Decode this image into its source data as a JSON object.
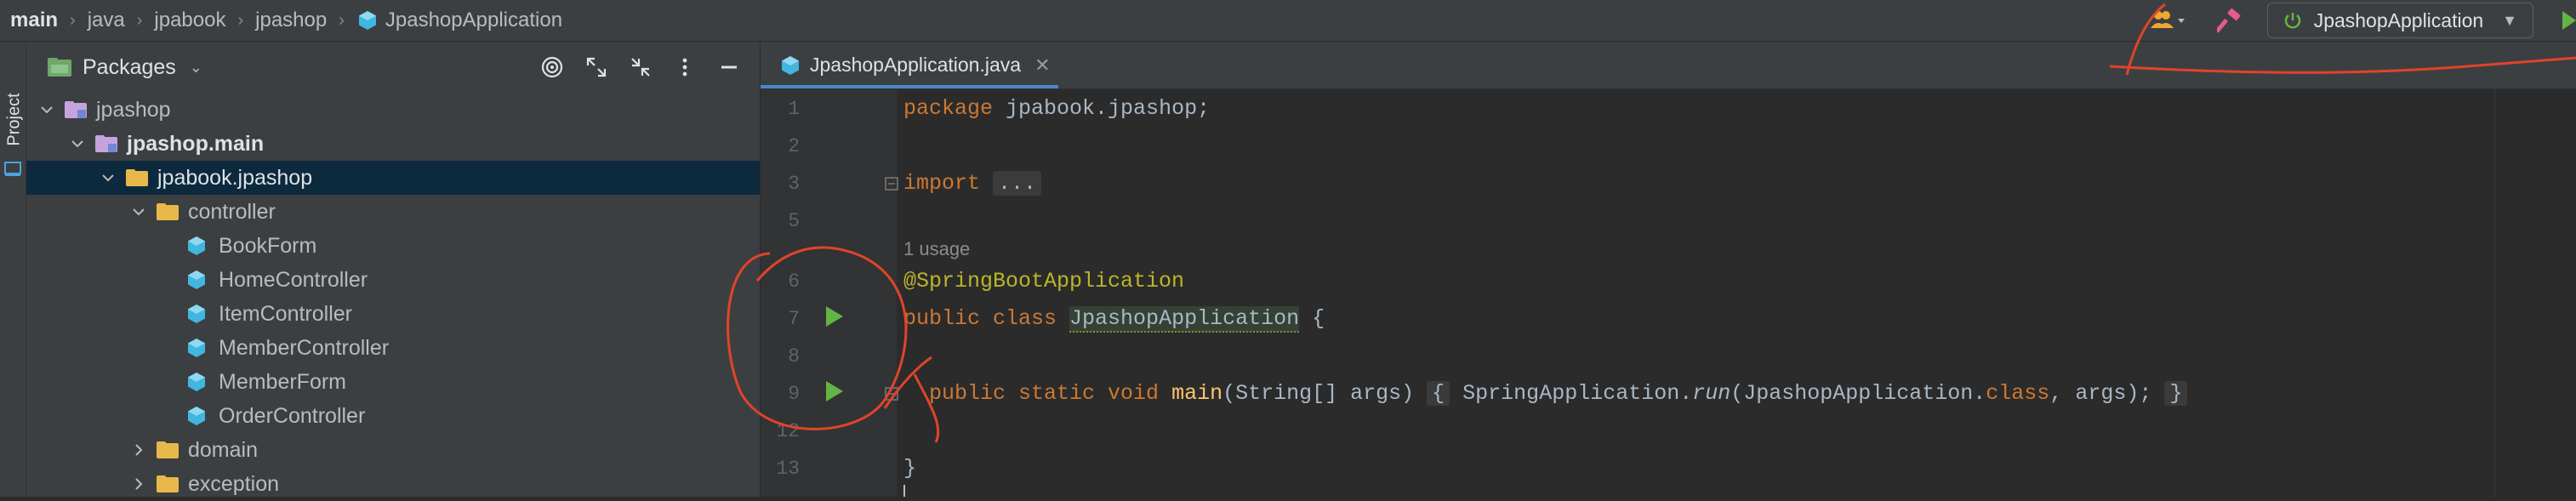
{
  "breadcrumb": {
    "items": [
      "main",
      "java",
      "jpabook",
      "jpashop"
    ],
    "current": "JpashopApplication"
  },
  "toolbar": {
    "run_config": "JpashopApplication"
  },
  "sidebar": {
    "project_label": "Project"
  },
  "project_panel": {
    "title": "Packages",
    "tree": [
      {
        "label": "jpashop",
        "icon": "module-folder-icon"
      },
      {
        "label": "jpashop.main",
        "icon": "module-folder-icon"
      },
      {
        "label": "jpabook.jpashop",
        "icon": "package-folder-icon"
      },
      {
        "label": "controller",
        "icon": "package-folder-icon"
      },
      {
        "label": "BookForm",
        "icon": "class-icon"
      },
      {
        "label": "HomeController",
        "icon": "class-icon"
      },
      {
        "label": "ItemController",
        "icon": "class-icon"
      },
      {
        "label": "MemberController",
        "icon": "class-icon"
      },
      {
        "label": "MemberForm",
        "icon": "class-icon"
      },
      {
        "label": "OrderController",
        "icon": "class-icon"
      },
      {
        "label": "domain",
        "icon": "package-folder-icon"
      },
      {
        "label": "exception",
        "icon": "package-folder-icon"
      }
    ]
  },
  "editor": {
    "tab": {
      "label": "JpashopApplication.java"
    },
    "line_numbers": [
      "1",
      "2",
      "3",
      "5",
      "6",
      "7",
      "8",
      "9",
      "12",
      "13"
    ],
    "usage_hint": "1 usage",
    "lines": {
      "l1_kw": "package",
      "l1_rest": " jpabook.jpashop;",
      "l3_kw": "import",
      "l3_fold": "...",
      "l6": "@SpringBootApplication",
      "l7_kw": "public class",
      "l7_cls": "JpashopApplication",
      "l7_rest": " {",
      "l9_kw": "public static void",
      "l9_fn": "main",
      "l9_args": "(String[] args)",
      "l9_open": "{",
      "l9_body1": " SpringApplication.",
      "l9_run": "run",
      "l9_body2": "(JpashopApplication.",
      "l9_class": "class",
      "l9_body3": ", args);",
      "l9_close": "}",
      "l13": "}"
    }
  },
  "colors": {
    "keyword": "#cc7832",
    "annotation": "#bbb529",
    "method": "#ffc66d",
    "selection": "#0d293e",
    "scribble": "#e0442a"
  }
}
